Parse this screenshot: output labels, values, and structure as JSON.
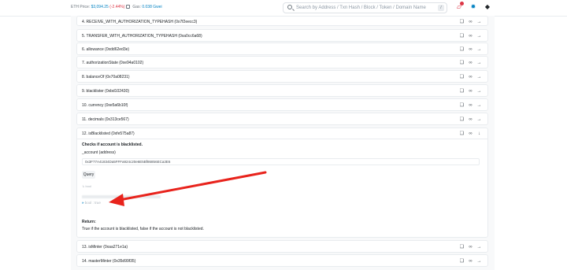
{
  "topbar": {
    "eth_price_label": "ETH Price:",
    "eth_price_value": "$3,094.25",
    "eth_price_change": "(-2.44%)",
    "gas_label": "Gas:",
    "gas_value": "0.038 Gwei",
    "search_placeholder": "Search by Address / Txn Hash / Block / Token / Domain Name",
    "search_shortcut": "/"
  },
  "functions": [
    {
      "label": "4. RECEIVE_WITH_AUTHORIZATION_TYPEHASH (0x7f2eecc3)"
    },
    {
      "label": "5. TRANSFER_WITH_AUTHORIZATION_TYPEHASH (0xa0cc6a68)"
    },
    {
      "label": "6. allowance (0xdd62ed3e)"
    },
    {
      "label": "7. authorizationState (0xe94a0102)"
    },
    {
      "label": "8. balanceOf (0x70a08231)"
    },
    {
      "label": "9. blacklister (0xbd102430)"
    },
    {
      "label": "10. currency (0xe5a6b10f)"
    },
    {
      "label": "11. decimals (0x313ce567)"
    },
    {
      "label": "12. isBlacklisted (0xfe575a87)"
    },
    {
      "label": "13. isMinter (0xaa271e1a)"
    },
    {
      "label": "14. masterMinter (0x35d99f35)"
    }
  ],
  "expanded": {
    "description": "Checks if account is blacklisted.",
    "param_label": "_account (address)",
    "param_value": "0x3F77A41834Da5FFFa924c20e6E5Bf86856ECa3E6",
    "query_label": "Query",
    "return_type": "↳ bool",
    "response_prefix": "bool :",
    "response_value": "true",
    "return_heading": "Return:",
    "return_desc": "True if the account is blacklisted, false if the account is not blacklisted."
  },
  "colors": {
    "accent": "#0784c3",
    "negative": "#dc3545",
    "annotation_arrow": "#e8231c"
  },
  "icons": {
    "row_icons": [
      "copy-icon",
      "link-icon",
      "arrow-right-icon"
    ],
    "expanded_row_icon": "arrow-down-icon"
  }
}
